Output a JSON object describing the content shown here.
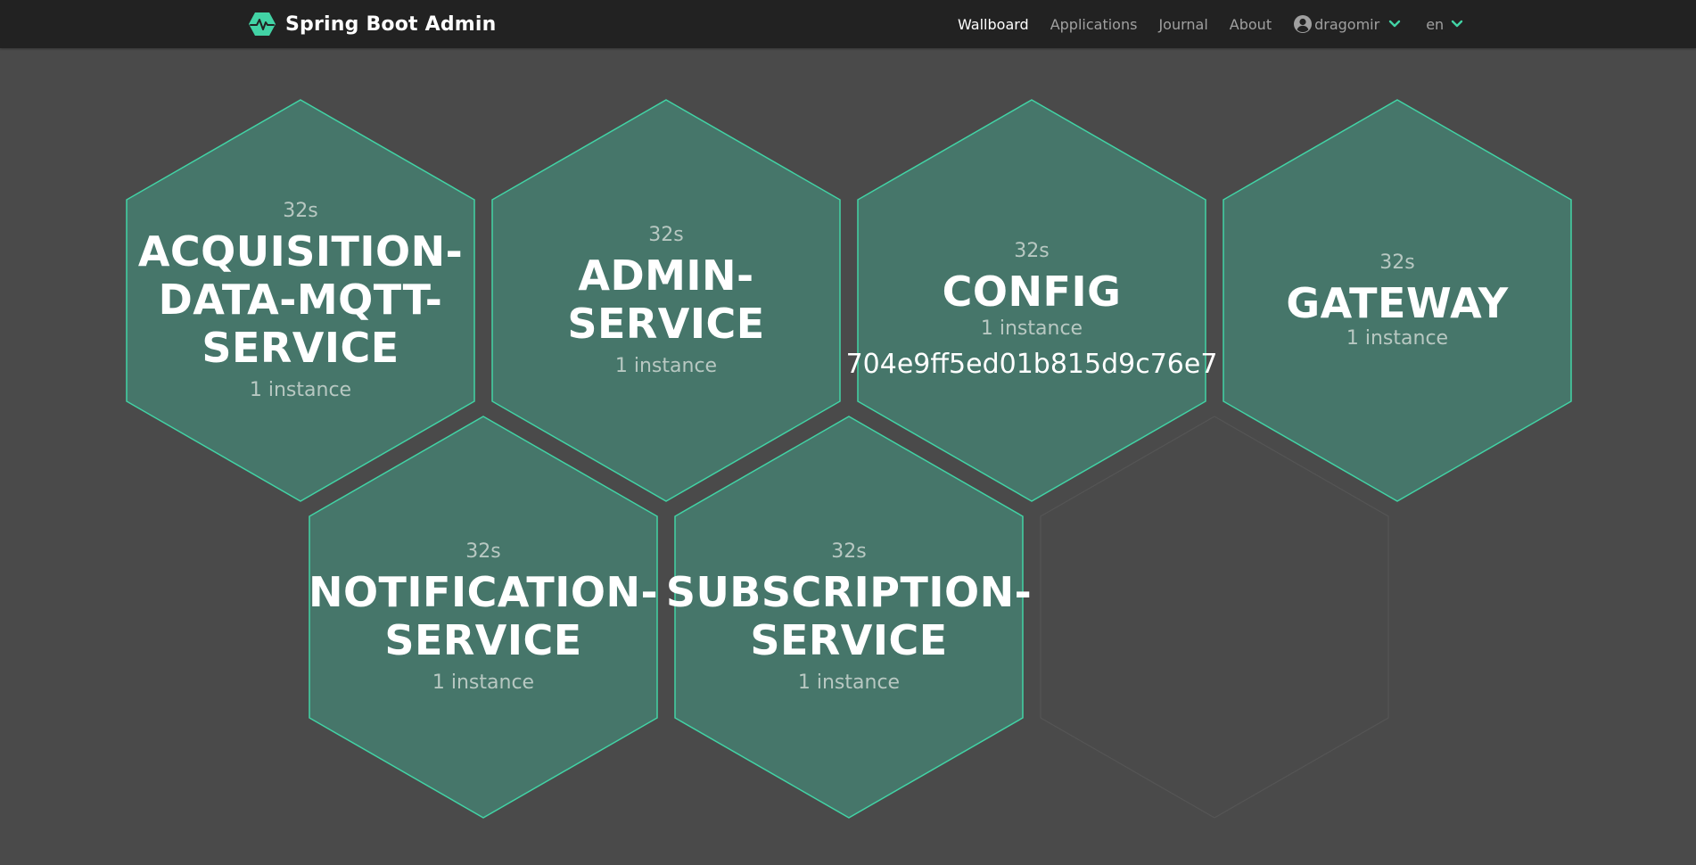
{
  "header": {
    "brand": "Spring Boot Admin",
    "nav": [
      {
        "label": "Wallboard",
        "active": true
      },
      {
        "label": "Applications",
        "active": false
      },
      {
        "label": "Journal",
        "active": false
      },
      {
        "label": "About",
        "active": false
      }
    ],
    "user": "dragomir",
    "language": "en"
  },
  "colors": {
    "accent": "#42d3a5",
    "hex_fill": "#46766a",
    "background": "#4a4a4a",
    "navbar": "#222222"
  },
  "applications": [
    {
      "time": "32s",
      "name": "ACQUISITION-\nDATA-MQTT-\nSERVICE",
      "instances": "1 instance"
    },
    {
      "time": "32s",
      "name": "ADMIN-\nSERVICE",
      "instances": "1 instance"
    },
    {
      "time": "32s",
      "name": "CONFIG",
      "instances": "1 instance",
      "version": "704e9ff5ed01b815d9c76e7"
    },
    {
      "time": "32s",
      "name": "GATEWAY",
      "instances": "1 instance"
    },
    {
      "time": "32s",
      "name": "NOTIFICATION-\nSERVICE",
      "instances": "1 instance"
    },
    {
      "time": "32s",
      "name": "SUBSCRIPTION-\nSERVICE",
      "instances": "1 instance"
    }
  ]
}
